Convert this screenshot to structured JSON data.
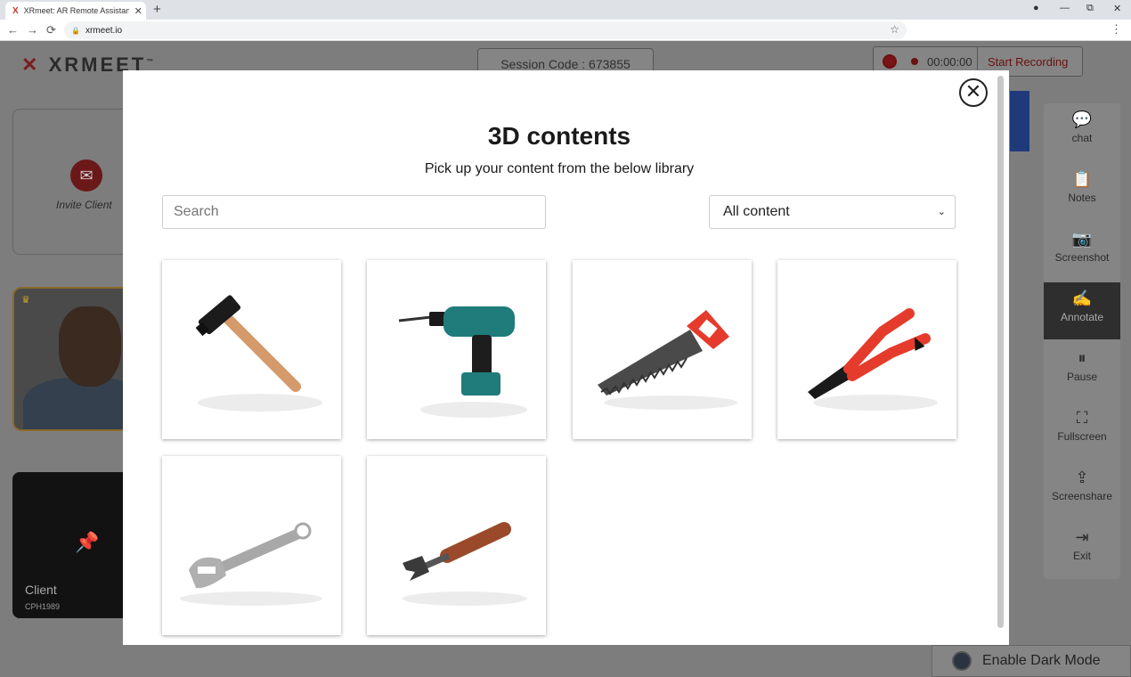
{
  "browser": {
    "tab_title": "XRmeet: AR Remote Assistance S",
    "tab_favicon": "X",
    "tab_close": "✕",
    "new_tab": "+",
    "url": "xrmeet.io",
    "lock_icon": "🔒",
    "back": "←",
    "forward": "→",
    "reload": "⟳",
    "minimize": "—",
    "maximize": "⧉",
    "close": "✕",
    "profile": "●",
    "star": "☆",
    "menu": "⋮"
  },
  "app": {
    "logo_x": "✕",
    "logo_text": "XRMEET",
    "logo_tm": "™",
    "session_code": "Session Code : 673855",
    "timer": "00:00:00",
    "start_recording": "Start Recording",
    "invite_label": "Invite Client",
    "mail_icon": "✉",
    "crown_icon": "♛",
    "pin_icon": "📌",
    "client_name": "Client",
    "client_code": "CPH1989",
    "dark_mode": "Enable Dark Mode",
    "side_buttons": [
      {
        "label": "chat",
        "icon": "💬"
      },
      {
        "label": "Notes",
        "icon": "📋"
      },
      {
        "label": "Screenshot",
        "icon": "📷"
      },
      {
        "label": "Annotate",
        "icon": "✍"
      },
      {
        "label": "Pause",
        "icon": "⏸"
      },
      {
        "label": "Fullscreen",
        "icon": "⛶"
      },
      {
        "label": "Screenshare",
        "icon": "⇪"
      },
      {
        "label": "Exit",
        "icon": "⇥"
      }
    ]
  },
  "modal": {
    "close_glyph": "✕",
    "title": "3D contents",
    "subtitle": "Pick up your content from the below library",
    "search_placeholder": "Search",
    "filter_value": "All content",
    "filter_chevron": "⌄",
    "items": [
      {
        "icon": "hammer-icon"
      },
      {
        "icon": "drill-icon"
      },
      {
        "icon": "saw-icon"
      },
      {
        "icon": "pliers-icon"
      },
      {
        "icon": "wrench-icon"
      },
      {
        "icon": "open-end-wrench-icon"
      }
    ]
  },
  "colors": {
    "accent_red": "#e53b2c",
    "teal": "#1f7c7a",
    "wood": "#d49a6a",
    "dark_wood": "#9a4a2a"
  }
}
